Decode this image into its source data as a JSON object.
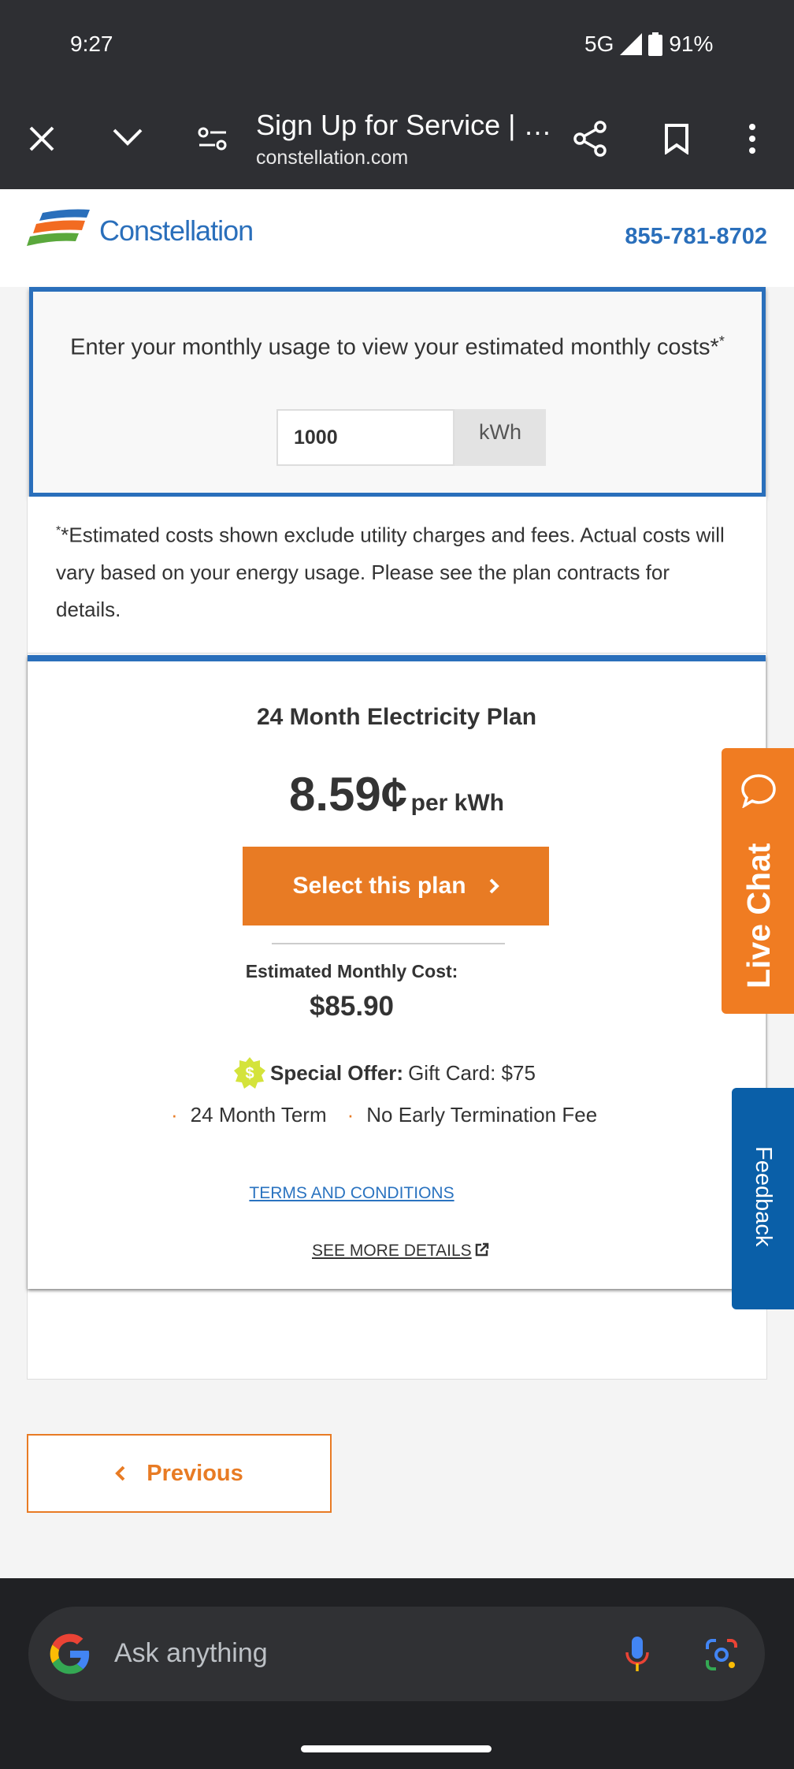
{
  "status_bar": {
    "time": "9:27",
    "network": "5G",
    "battery": "91%"
  },
  "browser": {
    "title": "Sign Up for Service | …",
    "url": "constellation.com"
  },
  "site_header": {
    "logo_text": "Constellation",
    "phone": "855-781-8702"
  },
  "usage": {
    "prompt": "Enter your monthly usage to view your estimated monthly costs*",
    "prompt_sup": "*",
    "value": "1000",
    "unit": "kWh"
  },
  "disclaimer": {
    "sup": "*",
    "text": "*Estimated costs shown exclude utility charges and fees. Actual costs will vary based on your energy usage. Please see the plan contracts for details."
  },
  "plan": {
    "title": "24 Month Electricity Plan",
    "rate": "8.59¢",
    "rate_unit": "per kWh",
    "select_label": "Select this plan",
    "est_label": "Estimated Monthly Cost:",
    "est_value": "$85.90",
    "offer_label": "Special Offer:",
    "offer_value": "Gift Card: $75",
    "features": [
      "24 Month Term",
      "No Early Termination Fee"
    ],
    "terms_link": "TERMS AND CONDITIONS",
    "details_link": "SEE MORE DETAILS"
  },
  "live_chat": "Live Chat",
  "feedback": "Feedback",
  "previous_label": "Previous",
  "search": {
    "placeholder": "Ask anything"
  },
  "colors": {
    "brand_blue": "#2a6fbb",
    "orange": "#e87b24",
    "feedback_blue": "#0a5fa8"
  }
}
